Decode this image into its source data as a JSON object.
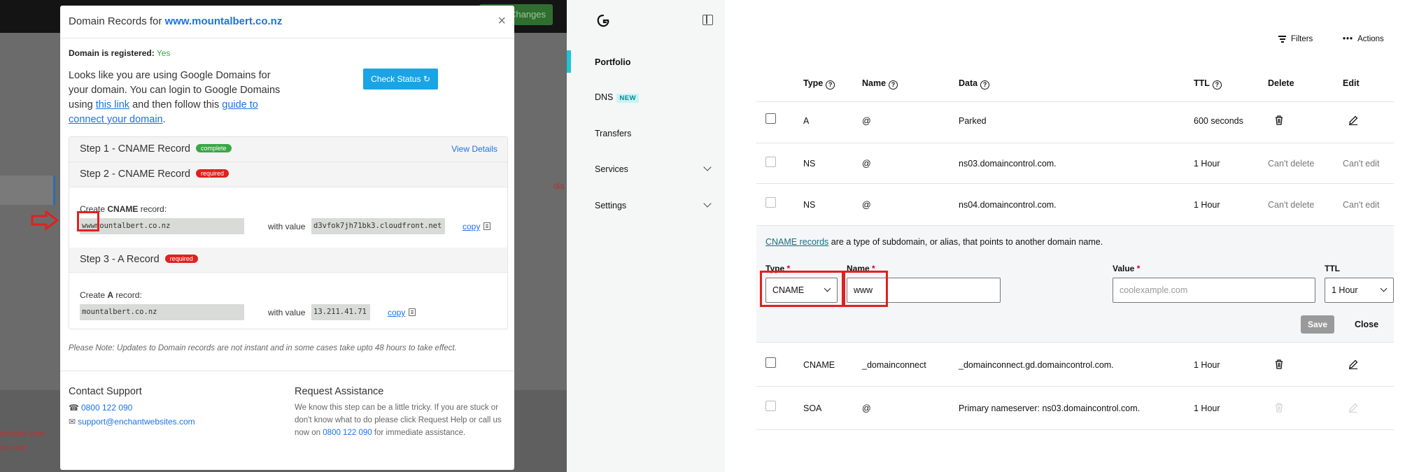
{
  "left_app": {
    "save_changes_label": "Changes",
    "bg_red_text": "dis",
    "bg_link1": "ebsites.com",
    "bg_link2": "es.com"
  },
  "modal": {
    "title_prefix": "Domain Records for ",
    "domain": "www.mountalbert.co.nz",
    "close_label": "×",
    "registered_label": "Domain is registered:",
    "registered_value": "Yes",
    "info_part1": "Looks like you are using Google Domains for your domain. You can login to Google Domains using ",
    "info_link1": "this link",
    "info_part2": " and then follow this ",
    "info_link2": "guide to connect your domain",
    "info_part3": ".",
    "check_status_label": "Check Status",
    "step1_title": "Step 1 - CNAME Record",
    "step1_badge": "complete",
    "view_details_label": "View Details",
    "step2_title": "Step 2 - CNAME Record",
    "step2_badge": "required",
    "step2_create_prefix": "Create ",
    "step2_create_type": "CNAME",
    "step2_create_suffix": " record:",
    "step2_name_prefix": "www",
    "step2_name_rest": "mountalbert.co.nz",
    "with_value_label": "with value",
    "step2_value": "d3vfok7jh71bk3.cloudfront.net",
    "copy_label": "copy",
    "step3_title": "Step 3 - A Record",
    "step3_badge": "required",
    "step3_create_prefix": "Create ",
    "step3_create_type": "A",
    "step3_create_suffix": " record:",
    "step3_name": "mountalbert.co.nz",
    "step3_value": "13.211.41.71",
    "note": "Please Note: Updates to Domain records are not instant and in some cases take upto 48 hours to take effect.",
    "contact_heading": "Contact Support",
    "contact_phone": "0800 122 090",
    "contact_email": "support@enchantwebsites.com",
    "assist_heading": "Request Assistance",
    "assist_text": "We know this step can be a little tricky. If you are stuck or don't know what to do please click Request Help or call us now on ",
    "assist_phone": "0800 122 090",
    "assist_text_end": " for immediate assistance."
  },
  "sidebar": {
    "items": [
      {
        "label": "Portfolio",
        "active": true
      },
      {
        "label": "DNS",
        "badge": "NEW"
      },
      {
        "label": "Transfers"
      },
      {
        "label": "Services"
      },
      {
        "label": "Settings"
      }
    ]
  },
  "dns": {
    "filters_label": "Filters",
    "actions_label": "Actions",
    "headers": {
      "type": "Type",
      "name": "Name",
      "data": "Data",
      "ttl": "TTL",
      "delete": "Delete",
      "edit": "Edit"
    },
    "rows": [
      {
        "type": "A",
        "name": "@",
        "data": "Parked",
        "ttl": "600 seconds"
      },
      {
        "type": "NS",
        "name": "@",
        "data": "ns03.domaincontrol.com.",
        "ttl": "1 Hour",
        "delete": "Can't delete",
        "edit": "Can't edit"
      },
      {
        "type": "NS",
        "name": "@",
        "data": "ns04.domaincontrol.com.",
        "ttl": "1 Hour",
        "delete": "Can't delete",
        "edit": "Can't edit"
      },
      {
        "type": "CNAME",
        "name": "_domainconnect",
        "data": "_domainconnect.gd.domaincontrol.com.",
        "ttl": "1 Hour"
      },
      {
        "type": "SOA",
        "name": "@",
        "data": "Primary nameserver: ns03.domaincontrol.com.",
        "ttl": "1 Hour"
      }
    ],
    "form": {
      "desc_link": "CNAME records",
      "desc_text": " are a type of subdomain, or alias, that points to another domain name.",
      "type_label": "Type",
      "type_value": "CNAME",
      "name_label": "Name",
      "name_value": "www",
      "value_label": "Value",
      "value_placeholder": "coolexample.com",
      "ttl_label": "TTL",
      "ttl_value": "1 Hour",
      "required_mark": "*",
      "save_label": "Save",
      "close_label": "Close"
    }
  },
  "colors": {
    "highlight": "#e0211f",
    "accent": "#1bc6d4",
    "link": "#1a73e8"
  }
}
